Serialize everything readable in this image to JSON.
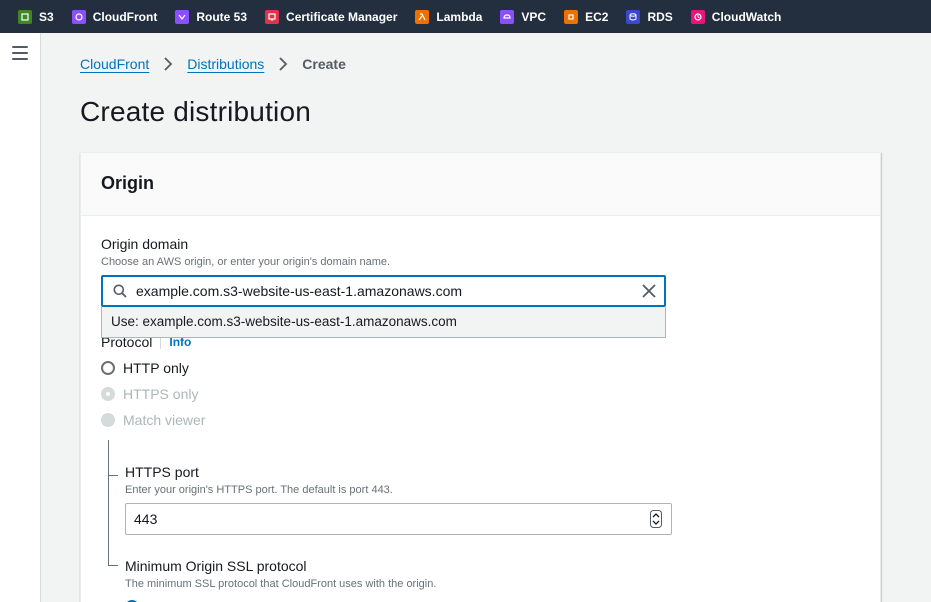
{
  "topbar": {
    "services": [
      {
        "label": "S3",
        "icon": "s3-icon",
        "color": "#3f8624"
      },
      {
        "label": "CloudFront",
        "icon": "cloudfront-icon",
        "color": "#8c4fff"
      },
      {
        "label": "Route 53",
        "icon": "route53-icon",
        "color": "#8c4fff"
      },
      {
        "label": "Certificate Manager",
        "icon": "certificate-manager-icon",
        "color": "#dd344c"
      },
      {
        "label": "Lambda",
        "icon": "lambda-icon",
        "color": "#ed7100"
      },
      {
        "label": "VPC",
        "icon": "vpc-icon",
        "color": "#8c4fff"
      },
      {
        "label": "EC2",
        "icon": "ec2-icon",
        "color": "#ed7100"
      },
      {
        "label": "RDS",
        "icon": "rds-icon",
        "color": "#3b48cc"
      },
      {
        "label": "CloudWatch",
        "icon": "cloudwatch-icon",
        "color": "#e7157b"
      }
    ]
  },
  "breadcrumb": {
    "items": [
      "CloudFront",
      "Distributions"
    ],
    "current": "Create"
  },
  "page": {
    "title": "Create distribution"
  },
  "origin_panel": {
    "title": "Origin",
    "origin_domain": {
      "label": "Origin domain",
      "description": "Choose an AWS origin, or enter your origin's domain name.",
      "value": "example.com.s3-website-us-east-1.amazonaws.com",
      "suggestion": "Use: example.com.s3-website-us-east-1.amazonaws.com"
    },
    "protocol": {
      "label": "Protocol",
      "info": "Info",
      "options": [
        "HTTP only",
        "HTTPS only",
        "Match viewer"
      ]
    },
    "https_port": {
      "label": "HTTPS port",
      "description": "Enter your origin's HTTPS port. The default is port 443.",
      "value": "443"
    },
    "ssl_protocol": {
      "label": "Minimum Origin SSL protocol",
      "description": "The minimum SSL protocol that CloudFront uses with the origin."
    }
  },
  "colors": {
    "topbar_bg": "#232f3e",
    "link": "#0073bb",
    "focus": "#0073bb"
  }
}
